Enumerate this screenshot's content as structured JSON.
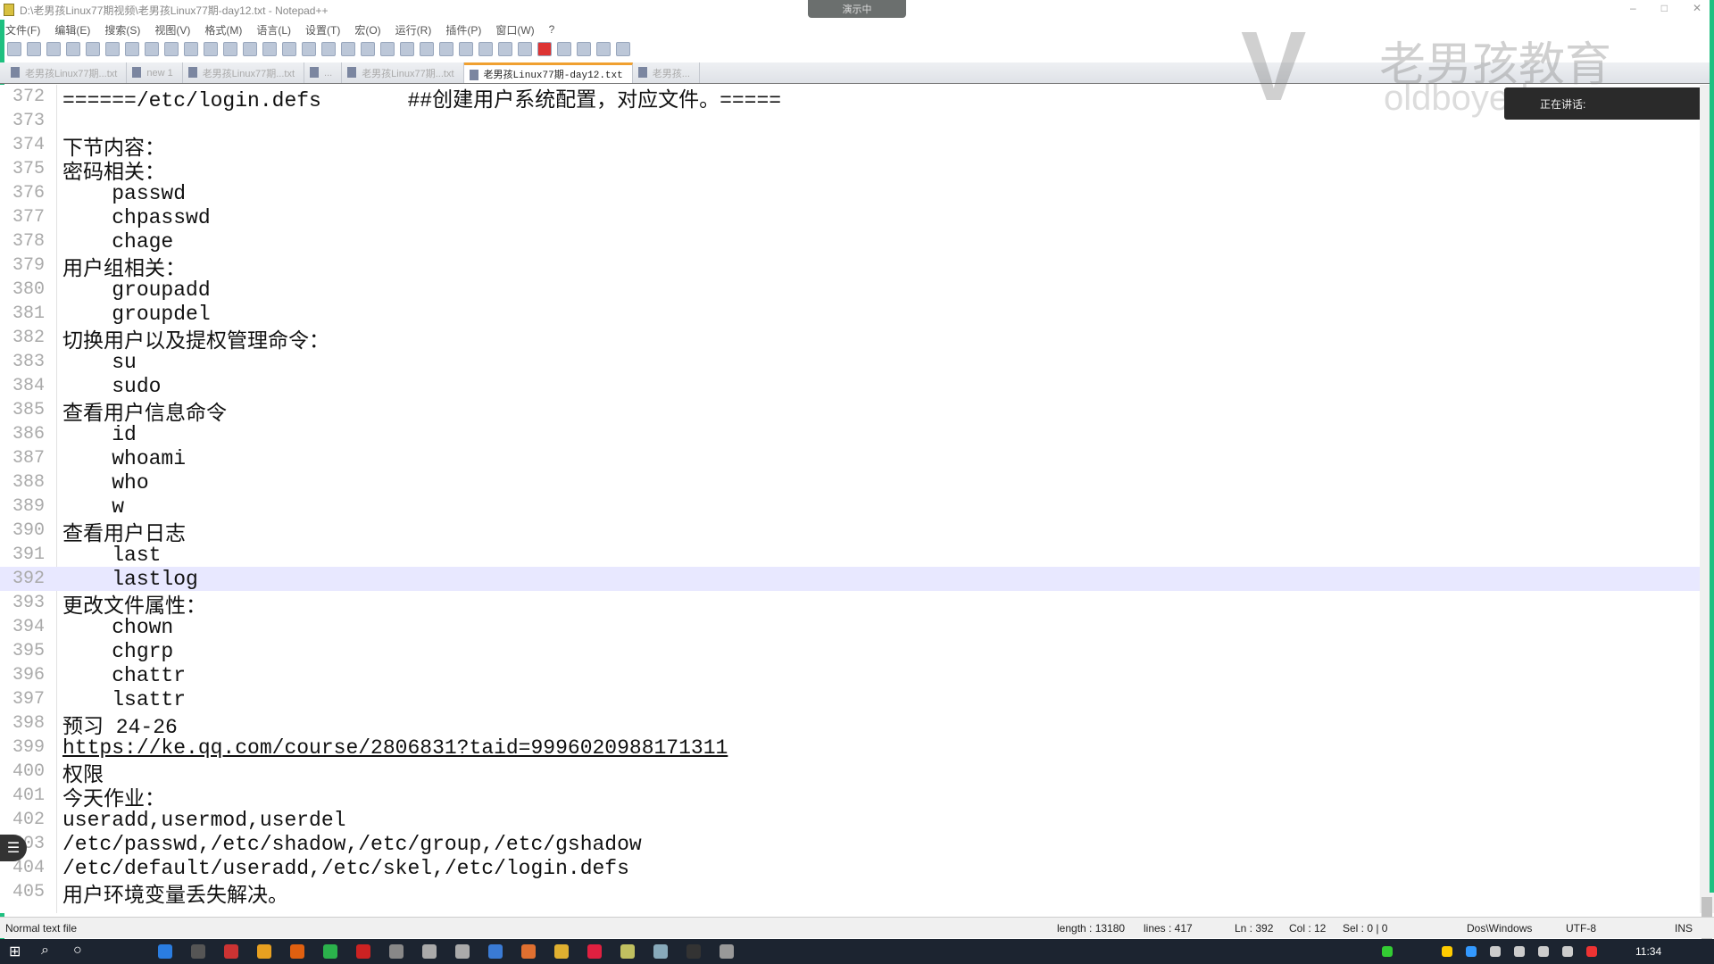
{
  "window": {
    "title": "D:\\老男孩Linux77期视频\\老男孩Linux77期-day12.txt - Notepad++",
    "controls": [
      "–",
      "□",
      "✕"
    ]
  },
  "recording_badge": "演示中",
  "menu": [
    "文件(F)",
    "编辑(E)",
    "搜索(S)",
    "视图(V)",
    "格式(M)",
    "语言(L)",
    "设置(T)",
    "宏(O)",
    "运行(R)",
    "插件(P)",
    "窗口(W)",
    "?"
  ],
  "tabs": [
    {
      "label": "老男孩Linux77期...txt",
      "active": false
    },
    {
      "label": "new 1",
      "active": false
    },
    {
      "label": "老男孩Linux77期...txt",
      "active": false
    },
    {
      "label": "...",
      "active": false
    },
    {
      "label": "老男孩Linux77期...txt",
      "active": false
    },
    {
      "label": "老男孩Linux77期-day12.txt",
      "active": true
    },
    {
      "label": "老男孩...",
      "active": false
    }
  ],
  "watermark": {
    "logo": "V",
    "cn": "老男孩教育",
    "en": "oldboyedu.com"
  },
  "speaking_label": "正在讲话:",
  "lines": [
    {
      "n": "372",
      "t": "======/etc/login.defs       ##创建用户系统配置，对应文件。====="
    },
    {
      "n": "373",
      "t": ""
    },
    {
      "n": "374",
      "t": "下节内容："
    },
    {
      "n": "375",
      "t": "密码相关："
    },
    {
      "n": "376",
      "t": "    passwd"
    },
    {
      "n": "377",
      "t": "    chpasswd"
    },
    {
      "n": "378",
      "t": "    chage"
    },
    {
      "n": "379",
      "t": "用户组相关："
    },
    {
      "n": "380",
      "t": "    groupadd"
    },
    {
      "n": "381",
      "t": "    groupdel"
    },
    {
      "n": "382",
      "t": "切换用户以及提权管理命令："
    },
    {
      "n": "383",
      "t": "    su"
    },
    {
      "n": "384",
      "t": "    sudo"
    },
    {
      "n": "385",
      "t": "查看用户信息命令"
    },
    {
      "n": "386",
      "t": "    id"
    },
    {
      "n": "387",
      "t": "    whoami"
    },
    {
      "n": "388",
      "t": "    who"
    },
    {
      "n": "389",
      "t": "    w"
    },
    {
      "n": "390",
      "t": "查看用户日志"
    },
    {
      "n": "391",
      "t": "    last"
    },
    {
      "n": "392",
      "t": "    lastlog",
      "current": true
    },
    {
      "n": "393",
      "t": "更改文件属性："
    },
    {
      "n": "394",
      "t": "    chown"
    },
    {
      "n": "395",
      "t": "    chgrp"
    },
    {
      "n": "396",
      "t": "    chattr"
    },
    {
      "n": "397",
      "t": "    lsattr"
    },
    {
      "n": "398",
      "t": "预习 24-26"
    },
    {
      "n": "399",
      "t": "https://ke.qq.com/course/2806831?taid=9996020988171311",
      "url": true
    },
    {
      "n": "400",
      "t": "权限"
    },
    {
      "n": "401",
      "t": "今天作业："
    },
    {
      "n": "402",
      "t": "useradd,usermod,userdel"
    },
    {
      "n": "403",
      "t": "/etc/passwd,/etc/shadow,/etc/group,/etc/gshadow"
    },
    {
      "n": "404",
      "t": "/etc/default/useradd,/etc/skel,/etc/login.defs"
    },
    {
      "n": "405",
      "t": "用户环境变量丢失解决。"
    }
  ],
  "status": {
    "type": "Normal text file",
    "length": "length : 13180",
    "lines": "lines : 417",
    "ln": "Ln : 392",
    "col": "Col : 12",
    "sel": "Sel : 0 | 0",
    "eol": "Dos\\Windows",
    "encoding": "UTF-8",
    "mode": "INS"
  },
  "taskbar": {
    "clock": "11:34"
  }
}
